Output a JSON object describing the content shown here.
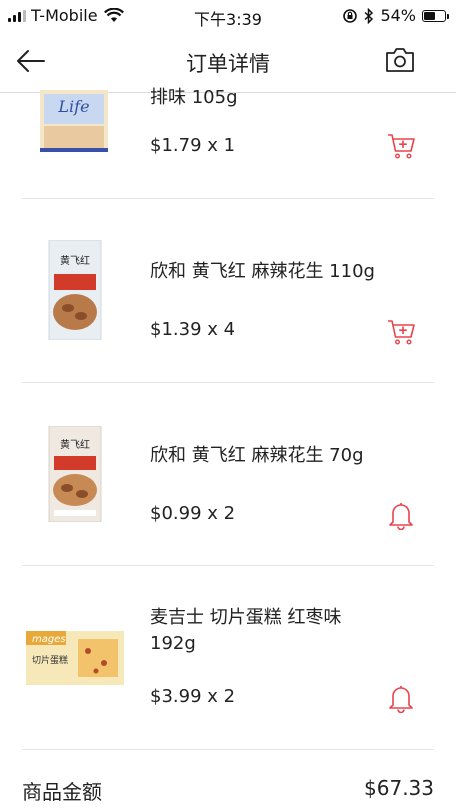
{
  "status_bar": {
    "carrier": "T-Mobile",
    "time": "下午3:39",
    "battery_percent": "54%",
    "battery_level": 0.54
  },
  "nav": {
    "title": "订单详情",
    "back_icon": "back-arrow-icon",
    "right_icon": "camera-icon"
  },
  "items": [
    {
      "name": "排味 105g",
      "price": "$1.79 x 1",
      "action_icon": "add-to-cart-icon"
    },
    {
      "name": "欣和 黄飞红 麻辣花生 110g",
      "price": "$1.39 x 4",
      "action_icon": "add-to-cart-icon"
    },
    {
      "name": "欣和 黄飞红 麻辣花生 70g",
      "price": "$0.99 x 2",
      "action_icon": "bell-icon"
    },
    {
      "name": "麦吉士 切片蛋糕 红枣味 192g",
      "price": "$3.99 x 2",
      "action_icon": "bell-icon"
    }
  ],
  "summary": {
    "label": "商品金额",
    "value": "$67.33"
  },
  "colors": {
    "accent": "#e8434b"
  }
}
